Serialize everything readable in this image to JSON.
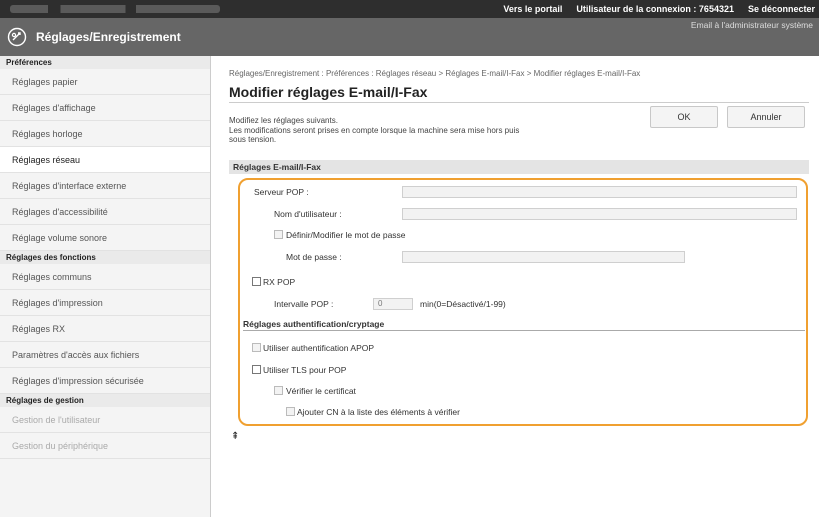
{
  "topbar": {
    "portal_link": "Vers le portail",
    "user_label": "Utilisateur de la connexion : 7654321",
    "logout_link": "Se déconnecter"
  },
  "header": {
    "title": "Réglages/Enregistrement",
    "admin_mail": "Email à l'administrateur système"
  },
  "sidebar": {
    "cat_preferences": "Préférences",
    "preferences": [
      "Réglages papier",
      "Réglages d'affichage",
      "Réglages horloge",
      "Réglages réseau",
      "Réglages d'interface externe",
      "Réglages d'accessibilité",
      "Réglage volume sonore"
    ],
    "active_item": "Réglages réseau",
    "cat_functions": "Réglages des fonctions",
    "functions": [
      "Réglages communs",
      "Réglages d'impression",
      "Réglages RX",
      "Paramètres d'accès aux fichiers",
      "Réglages d'impression sécurisée"
    ],
    "cat_management": "Réglages de gestion",
    "management": [
      "Gestion de l'utilisateur",
      "Gestion du périphérique"
    ]
  },
  "main": {
    "breadcrumb": "Réglages/Enregistrement : Préférences : Réglages réseau > Réglages E-mail/I-Fax > Modifier réglages E-mail/I-Fax",
    "title": "Modifier réglages E-mail/I-Fax",
    "desc_line1": "Modifiez les réglages suivants.",
    "desc_line2": "Les modifications seront prises en compte lorsque la machine sera mise hors puis",
    "desc_line3": "sous tension.",
    "ok_label": "OK",
    "cancel_label": "Annuler",
    "section_title": "Réglages E-mail/I-Fax"
  },
  "form": {
    "pop_server_label": "Serveur POP :",
    "pop_server_value": "",
    "username_label": "Nom d'utilisateur :",
    "username_value": "",
    "set_password_label": "Définir/Modifier le mot de passe",
    "password_label": "Mot de passe :",
    "password_value": "",
    "rx_pop_label": "RX POP",
    "pop_interval_label": "Intervalle POP :",
    "pop_interval_value": "0",
    "pop_interval_unit": "min(0=Désactivé/1-99)",
    "auth_section_title": "Réglages authentification/cryptage",
    "apop_label": "Utiliser authentification APOP",
    "tls_label": "Utiliser TLS pour POP",
    "verify_cert_label": "Vérifier le certificat",
    "add_cn_label": "Ajouter CN à la liste des éléments à vérifier"
  },
  "page_top_arrow": "⇞",
  "colors": {
    "topbar_bg": "#2e2e2e",
    "header_bg": "#666666",
    "highlight_border": "#f0a030"
  }
}
